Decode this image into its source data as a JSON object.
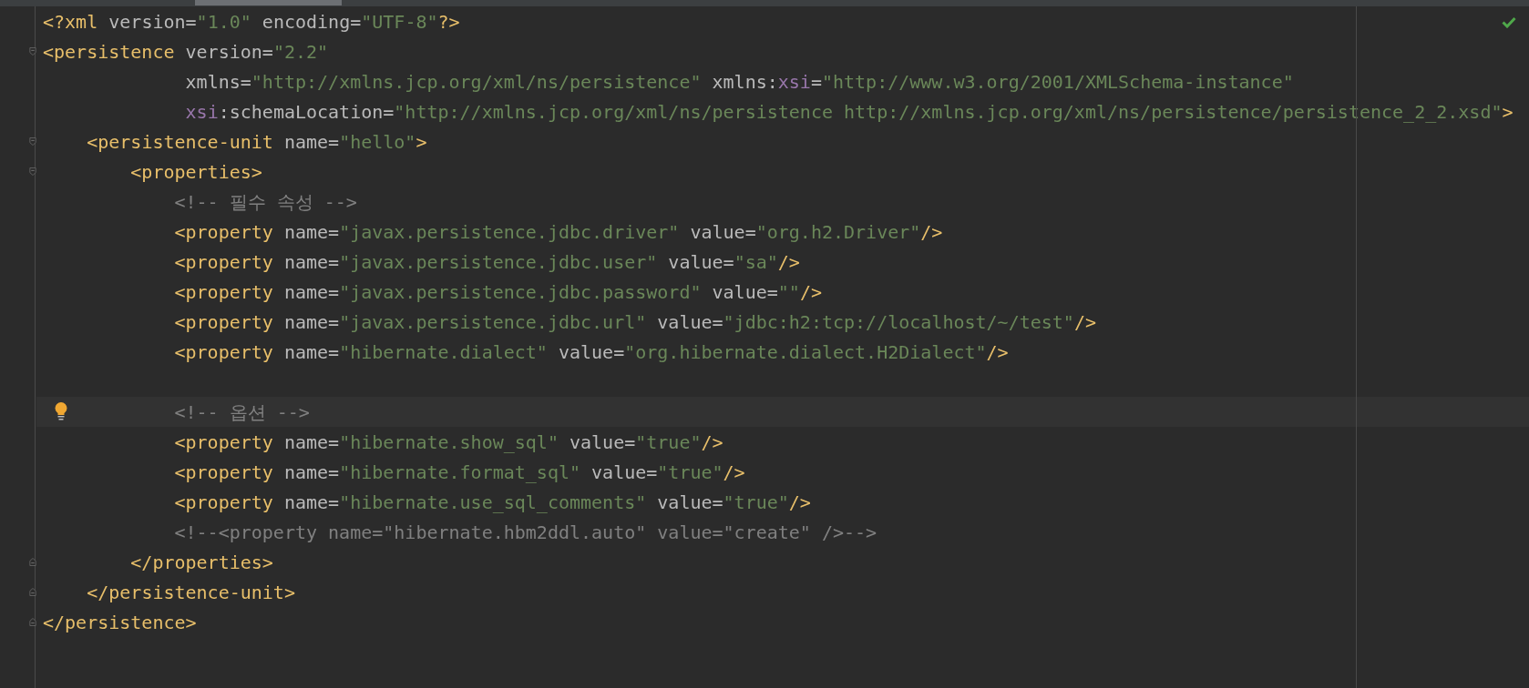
{
  "editor": {
    "inspection_ok": true,
    "lines": [
      {
        "current": false,
        "bulb": false,
        "fold_start": false,
        "fold_end": false,
        "tokens": [
          {
            "kind": "tag",
            "text": "<?xml"
          },
          {
            "kind": "attr",
            "text": " version="
          },
          {
            "kind": "val",
            "text": "\"1.0\""
          },
          {
            "kind": "attr",
            "text": " encoding="
          },
          {
            "kind": "val",
            "text": "\"UTF-8\""
          },
          {
            "kind": "tag",
            "text": "?>"
          }
        ]
      },
      {
        "current": false,
        "bulb": false,
        "fold_start": true,
        "fold_end": false,
        "tokens": [
          {
            "kind": "tag",
            "text": "<persistence"
          },
          {
            "kind": "attr",
            "text": " version="
          },
          {
            "kind": "val",
            "text": "\"2.2\""
          }
        ]
      },
      {
        "current": false,
        "bulb": false,
        "fold_start": false,
        "fold_end": false,
        "tokens": [
          {
            "kind": "attr",
            "text": "             xmlns="
          },
          {
            "kind": "val",
            "text": "\"http://xmlns.jcp.org/xml/ns/persistence\""
          },
          {
            "kind": "attr",
            "text": " xmlns:"
          },
          {
            "kind": "ns",
            "text": "xsi"
          },
          {
            "kind": "attr",
            "text": "="
          },
          {
            "kind": "val",
            "text": "\"http://www.w3.org/2001/XMLSchema-instance\""
          }
        ]
      },
      {
        "current": false,
        "bulb": false,
        "fold_start": false,
        "fold_end": false,
        "tokens": [
          {
            "kind": "ns",
            "text": "             xsi"
          },
          {
            "kind": "attr",
            "text": ":schemaLocation="
          },
          {
            "kind": "val",
            "text": "\"http://xmlns.jcp.org/xml/ns/persistence http://xmlns.jcp.org/xml/ns/persistence/persistence_2_2.xsd\""
          },
          {
            "kind": "tag",
            "text": ">"
          }
        ]
      },
      {
        "current": false,
        "bulb": false,
        "fold_start": true,
        "fold_end": false,
        "tokens": [
          {
            "kind": "tag",
            "text": "    <persistence-unit"
          },
          {
            "kind": "attr",
            "text": " name="
          },
          {
            "kind": "val",
            "text": "\"hello\""
          },
          {
            "kind": "tag",
            "text": ">"
          }
        ]
      },
      {
        "current": false,
        "bulb": false,
        "fold_start": true,
        "fold_end": false,
        "tokens": [
          {
            "kind": "tag",
            "text": "        <properties>"
          }
        ]
      },
      {
        "current": false,
        "bulb": false,
        "fold_start": false,
        "fold_end": false,
        "tokens": [
          {
            "kind": "comment",
            "text": "            <!-- 필수 속성 -->"
          }
        ]
      },
      {
        "current": false,
        "bulb": false,
        "fold_start": false,
        "fold_end": false,
        "tokens": [
          {
            "kind": "tag",
            "text": "            <property"
          },
          {
            "kind": "attr",
            "text": " name="
          },
          {
            "kind": "val",
            "text": "\"javax.persistence.jdbc.driver\""
          },
          {
            "kind": "attr",
            "text": " value="
          },
          {
            "kind": "val",
            "text": "\"org.h2.Driver\""
          },
          {
            "kind": "tag",
            "text": "/>"
          }
        ]
      },
      {
        "current": false,
        "bulb": false,
        "fold_start": false,
        "fold_end": false,
        "tokens": [
          {
            "kind": "tag",
            "text": "            <property"
          },
          {
            "kind": "attr",
            "text": " name="
          },
          {
            "kind": "val",
            "text": "\"javax.persistence.jdbc.user\""
          },
          {
            "kind": "attr",
            "text": " value="
          },
          {
            "kind": "val",
            "text": "\"sa\""
          },
          {
            "kind": "tag",
            "text": "/>"
          }
        ]
      },
      {
        "current": false,
        "bulb": false,
        "fold_start": false,
        "fold_end": false,
        "tokens": [
          {
            "kind": "tag",
            "text": "            <property"
          },
          {
            "kind": "attr",
            "text": " name="
          },
          {
            "kind": "val",
            "text": "\"javax.persistence.jdbc.password\""
          },
          {
            "kind": "attr",
            "text": " value="
          },
          {
            "kind": "val",
            "text": "\"\""
          },
          {
            "kind": "tag",
            "text": "/>"
          }
        ]
      },
      {
        "current": false,
        "bulb": false,
        "fold_start": false,
        "fold_end": false,
        "tokens": [
          {
            "kind": "tag",
            "text": "            <property"
          },
          {
            "kind": "attr",
            "text": " name="
          },
          {
            "kind": "val",
            "text": "\"javax.persistence.jdbc.url\""
          },
          {
            "kind": "attr",
            "text": " value="
          },
          {
            "kind": "val",
            "text": "\"jdbc:h2:tcp://localhost/~/test\""
          },
          {
            "kind": "tag",
            "text": "/>"
          }
        ]
      },
      {
        "current": false,
        "bulb": false,
        "fold_start": false,
        "fold_end": false,
        "tokens": [
          {
            "kind": "tag",
            "text": "            <property"
          },
          {
            "kind": "attr",
            "text": " name="
          },
          {
            "kind": "val",
            "text": "\"hibernate.dialect\""
          },
          {
            "kind": "attr",
            "text": " value="
          },
          {
            "kind": "val",
            "text": "\"org.hibernate.dialect.H2Dialect\""
          },
          {
            "kind": "tag",
            "text": "/>"
          }
        ]
      },
      {
        "current": false,
        "bulb": false,
        "fold_start": false,
        "fold_end": false
      },
      {
        "current": true,
        "bulb": true,
        "fold_start": false,
        "fold_end": false,
        "tokens": [
          {
            "kind": "comment",
            "text": "            <!-- 옵션 -->"
          }
        ]
      },
      {
        "current": false,
        "bulb": false,
        "fold_start": false,
        "fold_end": false,
        "tokens": [
          {
            "kind": "tag",
            "text": "            <property"
          },
          {
            "kind": "attr",
            "text": " name="
          },
          {
            "kind": "val",
            "text": "\"hibernate.show_sql\""
          },
          {
            "kind": "attr",
            "text": " value="
          },
          {
            "kind": "val",
            "text": "\"true\""
          },
          {
            "kind": "tag",
            "text": "/>"
          }
        ]
      },
      {
        "current": false,
        "bulb": false,
        "fold_start": false,
        "fold_end": false,
        "tokens": [
          {
            "kind": "tag",
            "text": "            <property"
          },
          {
            "kind": "attr",
            "text": " name="
          },
          {
            "kind": "val",
            "text": "\"hibernate.format_sql\""
          },
          {
            "kind": "attr",
            "text": " value="
          },
          {
            "kind": "val",
            "text": "\"true\""
          },
          {
            "kind": "tag",
            "text": "/>"
          }
        ]
      },
      {
        "current": false,
        "bulb": false,
        "fold_start": false,
        "fold_end": false,
        "tokens": [
          {
            "kind": "tag",
            "text": "            <property"
          },
          {
            "kind": "attr",
            "text": " name="
          },
          {
            "kind": "val",
            "text": "\"hibernate.use_sql_comments\""
          },
          {
            "kind": "attr",
            "text": " value="
          },
          {
            "kind": "val",
            "text": "\"true\""
          },
          {
            "kind": "tag",
            "text": "/>"
          }
        ]
      },
      {
        "current": false,
        "bulb": false,
        "fold_start": false,
        "fold_end": false,
        "tokens": [
          {
            "kind": "comment",
            "text": "            <!--<property name=\"hibernate.hbm2ddl.auto\" value=\"create\" />-->"
          }
        ]
      },
      {
        "current": false,
        "bulb": false,
        "fold_start": false,
        "fold_end": true,
        "tokens": [
          {
            "kind": "tag",
            "text": "        </properties>"
          }
        ]
      },
      {
        "current": false,
        "bulb": false,
        "fold_start": false,
        "fold_end": true,
        "tokens": [
          {
            "kind": "tag",
            "text": "    </persistence-unit>"
          }
        ]
      },
      {
        "current": false,
        "bulb": false,
        "fold_start": false,
        "fold_end": true,
        "tokens": [
          {
            "kind": "tag",
            "text": "</persistence>"
          }
        ]
      }
    ]
  }
}
